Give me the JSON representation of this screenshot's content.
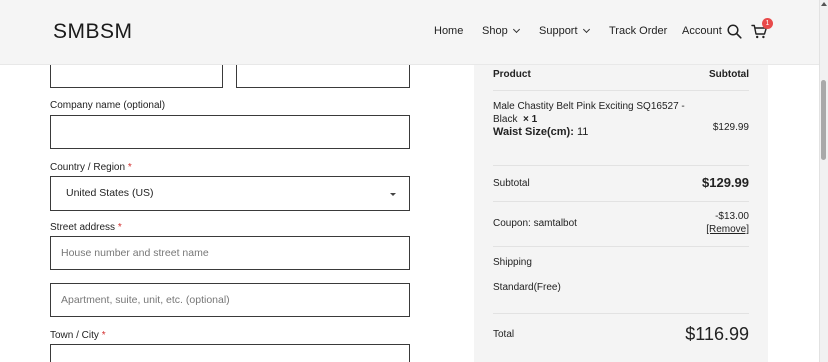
{
  "header": {
    "logo": "SMBSM",
    "nav": [
      {
        "label": "Home"
      },
      {
        "label": "Shop"
      },
      {
        "label": "Support"
      },
      {
        "label": "Track Order"
      },
      {
        "label": "Account"
      }
    ],
    "cart_count": "1"
  },
  "form": {
    "company_label": "Company name (optional)",
    "country_label": "Country / Region",
    "country_value": "United States (US)",
    "street_label": "Street address",
    "street_placeholder": "House number and street name",
    "apt_placeholder": "Apartment, suite, unit, etc. (optional)",
    "city_label": "Town / City",
    "required_mark": "*"
  },
  "summary": {
    "col_product": "Product",
    "col_subtotal": "Subtotal",
    "item": {
      "name_line1": "Male Chastity Belt Pink Exciting SQ16527 -",
      "name_line2": "Black",
      "qty": "× 1",
      "attr_label": "Waist Size(cm):",
      "attr_value": "11",
      "price": "$129.99"
    },
    "subtotal_label": "Subtotal",
    "subtotal_value": "$129.99",
    "coupon_label": "Coupon: samtalbot",
    "coupon_value": "-$13.00",
    "coupon_remove": "[Remove]",
    "shipping_label": "Shipping",
    "shipping_value": "Standard(Free)",
    "total_label": "Total",
    "total_value": "$116.99"
  }
}
